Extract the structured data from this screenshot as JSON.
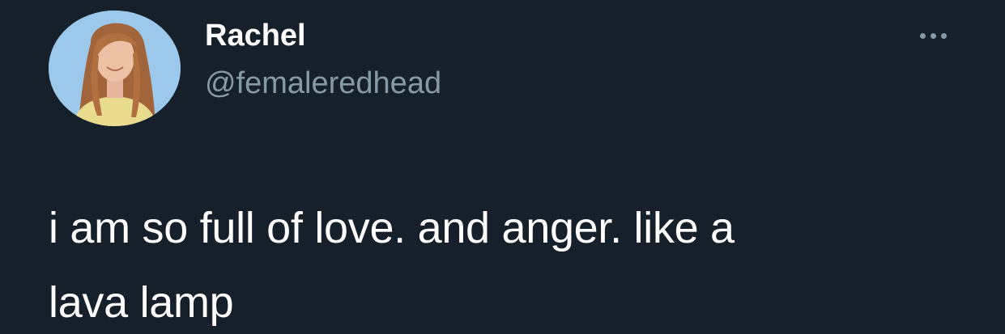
{
  "user": {
    "display_name": "Rachel",
    "handle": "@femaleredhead",
    "avatar_icon": "profile-photo",
    "avatar_bg": "#9cc8ec"
  },
  "tweet": {
    "text_lines": [
      "i am so full of love. and anger. like a",
      "lava lamp"
    ]
  },
  "menu": {
    "icon": "more-horizontal-icon"
  },
  "theme": {
    "background": "#15202b",
    "primary_text": "#ffffff",
    "secondary_text": "#8899a6"
  }
}
